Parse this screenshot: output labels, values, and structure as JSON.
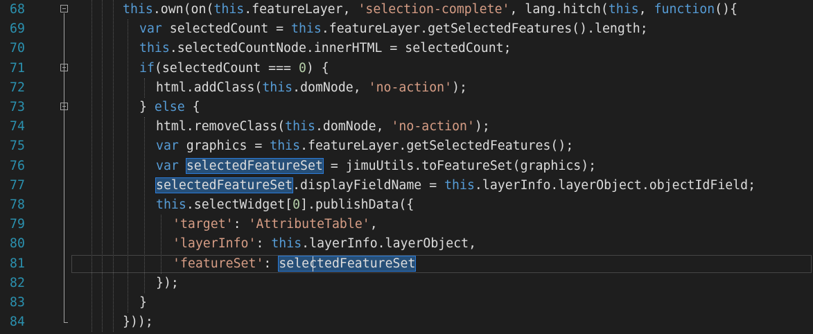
{
  "editor": {
    "line_numbers": [
      "68",
      "69",
      "70",
      "71",
      "72",
      "73",
      "74",
      "75",
      "76",
      "77",
      "78",
      "79",
      "80",
      "81",
      "82",
      "83",
      "84"
    ],
    "lines": [
      [
        {
          "t": "this",
          "c": "kw"
        },
        {
          "t": ".own(on(",
          "c": "plain"
        },
        {
          "t": "this",
          "c": "kw"
        },
        {
          "t": ".featureLayer, ",
          "c": "plain"
        },
        {
          "t": "'selection-complete'",
          "c": "str"
        },
        {
          "t": ", lang.hitch(",
          "c": "plain"
        },
        {
          "t": "this",
          "c": "kw"
        },
        {
          "t": ", ",
          "c": "plain"
        },
        {
          "t": "function",
          "c": "kw"
        },
        {
          "t": "(){",
          "c": "plain"
        }
      ],
      [
        {
          "t": "var",
          "c": "kw"
        },
        {
          "t": " selectedCount = ",
          "c": "plain"
        },
        {
          "t": "this",
          "c": "kw"
        },
        {
          "t": ".featureLayer.getSelectedFeatures().length;",
          "c": "plain"
        }
      ],
      [
        {
          "t": "this",
          "c": "kw"
        },
        {
          "t": ".selectedCountNode.innerHTML = selectedCount;",
          "c": "plain"
        }
      ],
      [
        {
          "t": "if",
          "c": "kw"
        },
        {
          "t": "(selectedCount === ",
          "c": "plain"
        },
        {
          "t": "0",
          "c": "num"
        },
        {
          "t": ") {",
          "c": "plain"
        }
      ],
      [
        {
          "t": "html.addClass(",
          "c": "plain"
        },
        {
          "t": "this",
          "c": "kw"
        },
        {
          "t": ".domNode, ",
          "c": "plain"
        },
        {
          "t": "'no-action'",
          "c": "str"
        },
        {
          "t": ");",
          "c": "plain"
        }
      ],
      [
        {
          "t": "} ",
          "c": "plain"
        },
        {
          "t": "else",
          "c": "kw"
        },
        {
          "t": " {",
          "c": "plain"
        }
      ],
      [
        {
          "t": "html.removeClass(",
          "c": "plain"
        },
        {
          "t": "this",
          "c": "kw"
        },
        {
          "t": ".domNode, ",
          "c": "plain"
        },
        {
          "t": "'no-action'",
          "c": "str"
        },
        {
          "t": ");",
          "c": "plain"
        }
      ],
      [
        {
          "t": "var",
          "c": "kw"
        },
        {
          "t": " graphics = ",
          "c": "plain"
        },
        {
          "t": "this",
          "c": "kw"
        },
        {
          "t": ".featureLayer.getSelectedFeatures();",
          "c": "plain"
        }
      ],
      [
        {
          "t": "var",
          "c": "kw"
        },
        {
          "t": " ",
          "c": "plain"
        },
        {
          "t": "selectedFeatureSet",
          "c": "plain hl"
        },
        {
          "t": " = jimuUtils.toFeatureSet(graphics);",
          "c": "plain"
        }
      ],
      [
        {
          "t": "selectedFeatureSet",
          "c": "plain hl"
        },
        {
          "t": ".displayFieldName = ",
          "c": "plain"
        },
        {
          "t": "this",
          "c": "kw"
        },
        {
          "t": ".layerInfo.layerObject.objectIdField;",
          "c": "plain"
        }
      ],
      [
        {
          "t": "this",
          "c": "kw"
        },
        {
          "t": ".selectWidget[",
          "c": "plain"
        },
        {
          "t": "0",
          "c": "num"
        },
        {
          "t": "].publishData({",
          "c": "plain"
        }
      ],
      [
        {
          "t": "'target'",
          "c": "str"
        },
        {
          "t": ": ",
          "c": "plain"
        },
        {
          "t": "'AttributeTable'",
          "c": "str"
        },
        {
          "t": ",",
          "c": "plain"
        }
      ],
      [
        {
          "t": "'layerInfo'",
          "c": "str"
        },
        {
          "t": ": ",
          "c": "plain"
        },
        {
          "t": "this",
          "c": "kw"
        },
        {
          "t": ".layerInfo.layerObject,",
          "c": "plain"
        }
      ],
      [
        {
          "t": "'featureSet'",
          "c": "str"
        },
        {
          "t": ": ",
          "c": "plain"
        },
        {
          "t": "selectedFeatureSet",
          "c": "plain hl"
        }
      ],
      [
        {
          "t": "});",
          "c": "plain"
        }
      ],
      [
        {
          "t": "}",
          "c": "plain"
        }
      ],
      [
        {
          "t": "}));",
          "c": "plain"
        }
      ]
    ]
  }
}
